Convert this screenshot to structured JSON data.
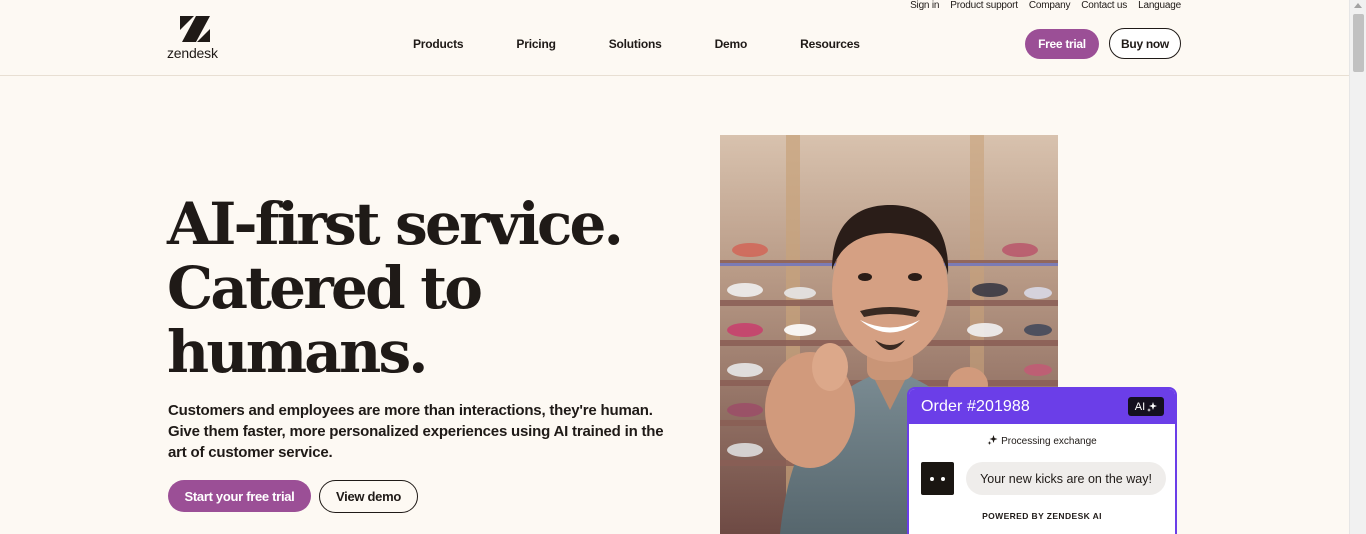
{
  "brand": {
    "name": "zendesk",
    "accent": "#9b4f96",
    "chat_accent": "#6b3ee8"
  },
  "utility_nav": [
    "Sign in",
    "Product support",
    "Company",
    "Contact us",
    "Language"
  ],
  "nav": [
    "Products",
    "Pricing",
    "Solutions",
    "Demo",
    "Resources"
  ],
  "header_buttons": {
    "free_trial": "Free trial",
    "buy_now": "Buy now"
  },
  "hero": {
    "headline": [
      "AI-first service.",
      "Catered to",
      "humans."
    ],
    "subtext": "Customers and employees are more than interactions, they're human. Give them faster, more personalized experiences using AI trained in the art of customer service.",
    "cta_primary": "Start your free trial",
    "cta_secondary": "View demo"
  },
  "chat_card": {
    "title": "Order #201988",
    "badge": "AI",
    "status": "Processing exchange",
    "message": "Your new kicks are on the way!",
    "footer": "POWERED BY ZENDESK AI"
  }
}
